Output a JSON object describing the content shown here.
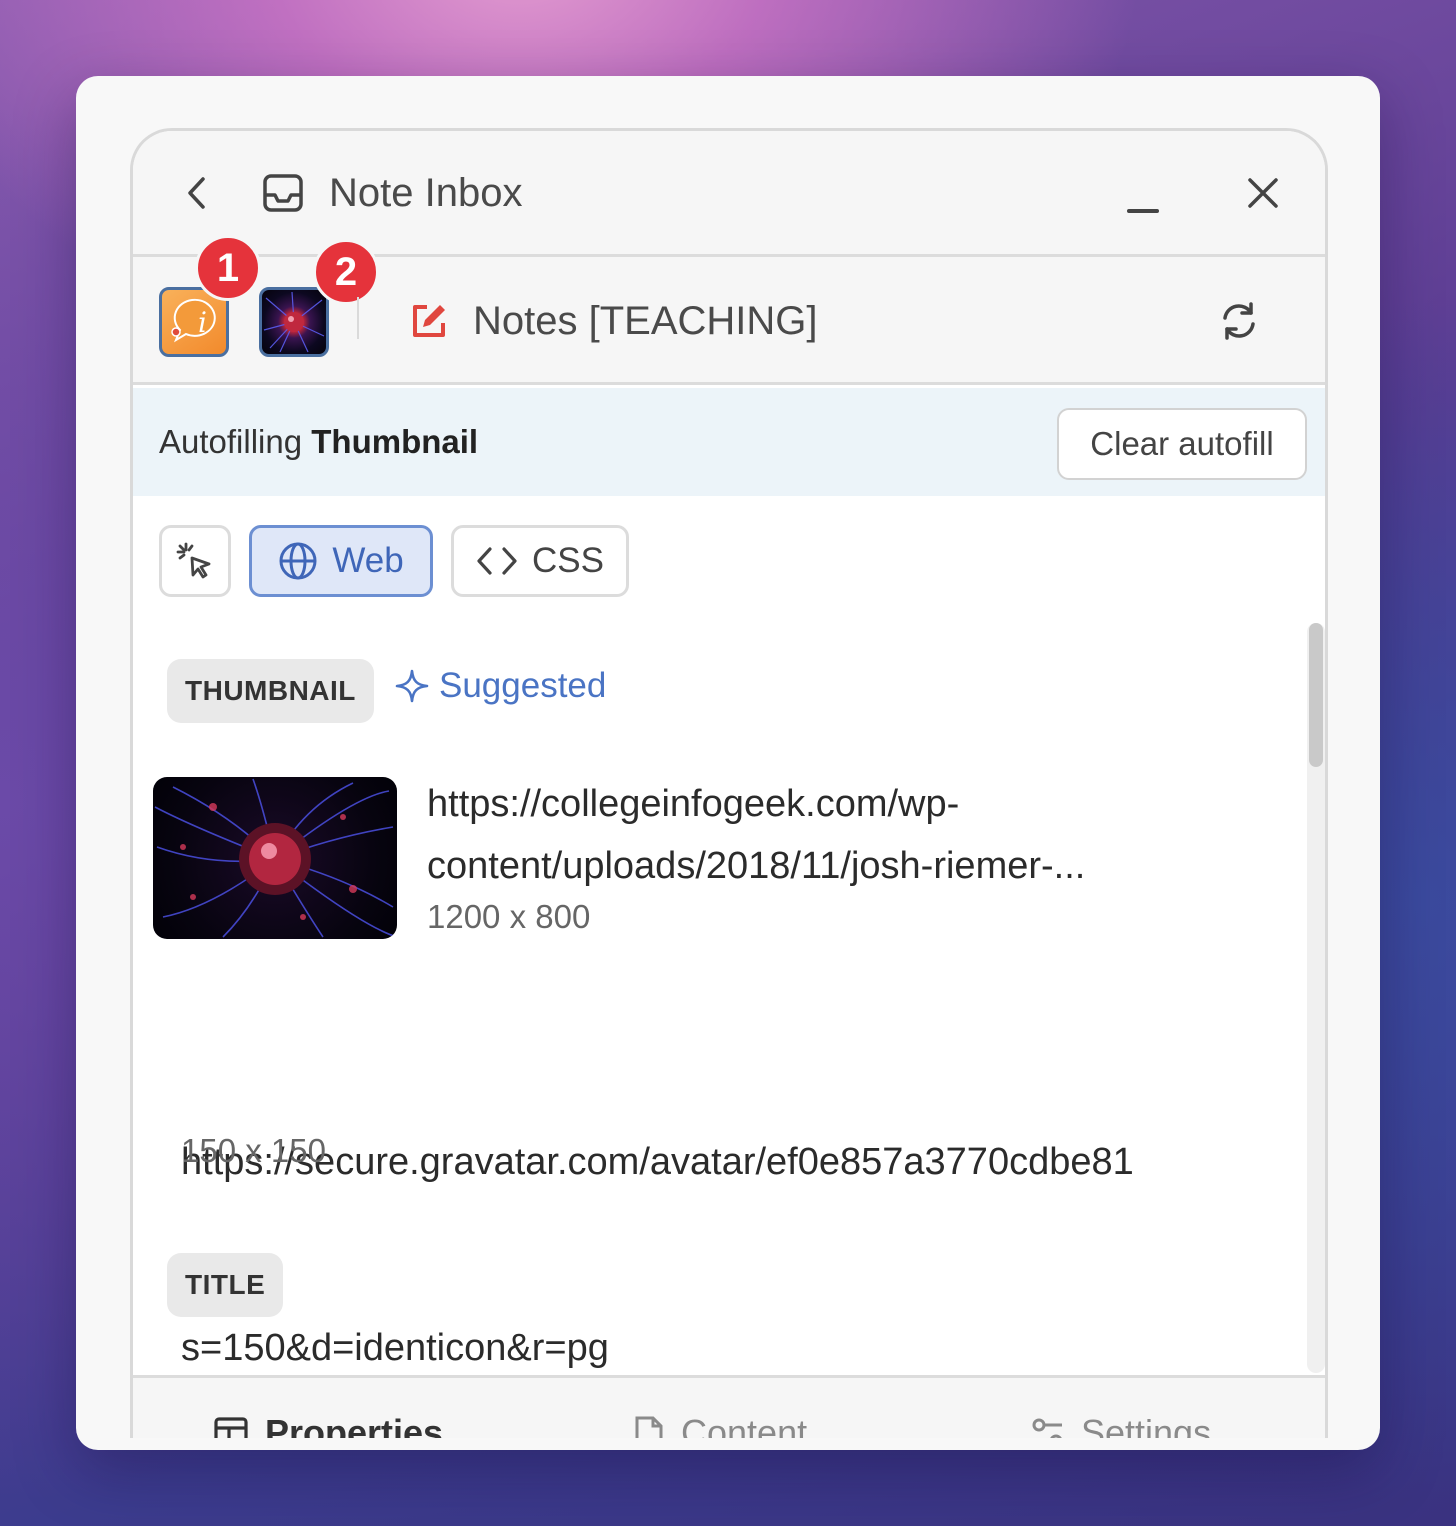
{
  "window": {
    "title": "Note Inbox",
    "back_icon": "chevron-left-icon",
    "inbox_icon": "inbox-icon",
    "minimize_icon": "minimize-icon",
    "close_icon": "close-icon"
  },
  "apps": [
    {
      "name": "info-app",
      "badge": "1"
    },
    {
      "name": "plasma-app",
      "badge": "2"
    }
  ],
  "note": {
    "title": "Notes [TEACHING]",
    "edit_icon": "edit-note-icon",
    "refresh_icon": "refresh-icon",
    "accent": "#e0473f"
  },
  "autofill": {
    "prefix": "Autofilling ",
    "field": "Thumbnail",
    "clear_label": "Clear autofill",
    "background": "#ecf4f9"
  },
  "modes": [
    {
      "name": "picker",
      "label": "",
      "icon": "cursor-click-icon",
      "active": false
    },
    {
      "name": "web",
      "label": "Web",
      "icon": "globe-icon",
      "active": true
    },
    {
      "name": "css",
      "label": "CSS",
      "icon": "code-icon",
      "active": false
    }
  ],
  "sections": {
    "thumbnail": {
      "label": "THUMBNAIL",
      "suggested_label": "Suggested",
      "results": [
        {
          "url_line1": "https://collegeinfogeek.com/wp-",
          "url_line2": "content/uploads/2018/11/josh-riemer-...",
          "size": "1200 x 800"
        },
        {
          "url_line1": "https://secure.gravatar.com/avatar/ef0e857a3770cdbe81",
          "url_line2": "s=150&d=identicon&r=pg",
          "size": "150 x 150"
        }
      ]
    },
    "title": {
      "label": "TITLE"
    }
  },
  "bottom_tabs": [
    {
      "label": "Properties",
      "icon": "table-icon",
      "active": true
    },
    {
      "label": "Content",
      "icon": "document-icon",
      "active": false
    },
    {
      "label": "Settings",
      "icon": "sliders-icon",
      "active": false
    }
  ],
  "colors": {
    "primary_blue": "#3f66b8",
    "badge_red": "#e5333b"
  }
}
